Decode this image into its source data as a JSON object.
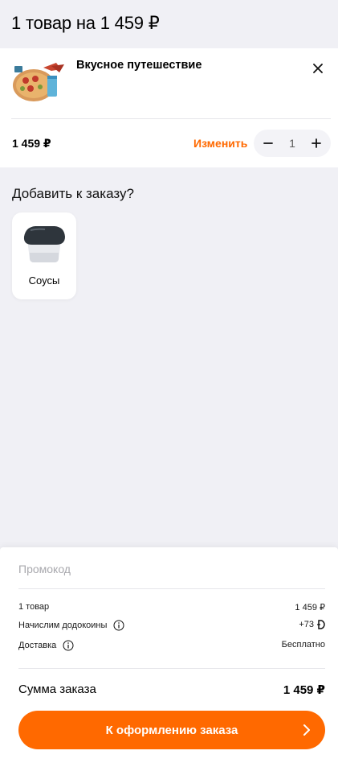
{
  "header": {
    "title": "1 товар на 1 459 ₽"
  },
  "cart_item": {
    "name": "Вкусное путешествие",
    "price": "1 459 ₽",
    "edit_label": "Изменить",
    "quantity": "1",
    "remove_icon": "close-icon",
    "minus_icon": "minus-icon",
    "plus_icon": "plus-icon"
  },
  "upsell": {
    "title": "Добавить к заказу?",
    "items": [
      {
        "label": "Соусы",
        "icon": "sauce-image"
      }
    ]
  },
  "summary": {
    "promo_placeholder": "Промокод",
    "rows": [
      {
        "label": "1 товар",
        "value": "1 459 ₽"
      },
      {
        "label": "Начислим додокоины",
        "value": "+73",
        "icon": "coin-icon",
        "info": true
      },
      {
        "label": "Доставка",
        "value": "Бесплатно",
        "info": true
      }
    ],
    "total_label": "Сумма заказа",
    "total_value": "1 459 ₽"
  },
  "checkout": {
    "label": "К оформлению заказа",
    "icon": "chevron-right-icon"
  },
  "colors": {
    "accent": "#ff6900",
    "background": "#f0f0f5",
    "card": "#ffffff"
  }
}
